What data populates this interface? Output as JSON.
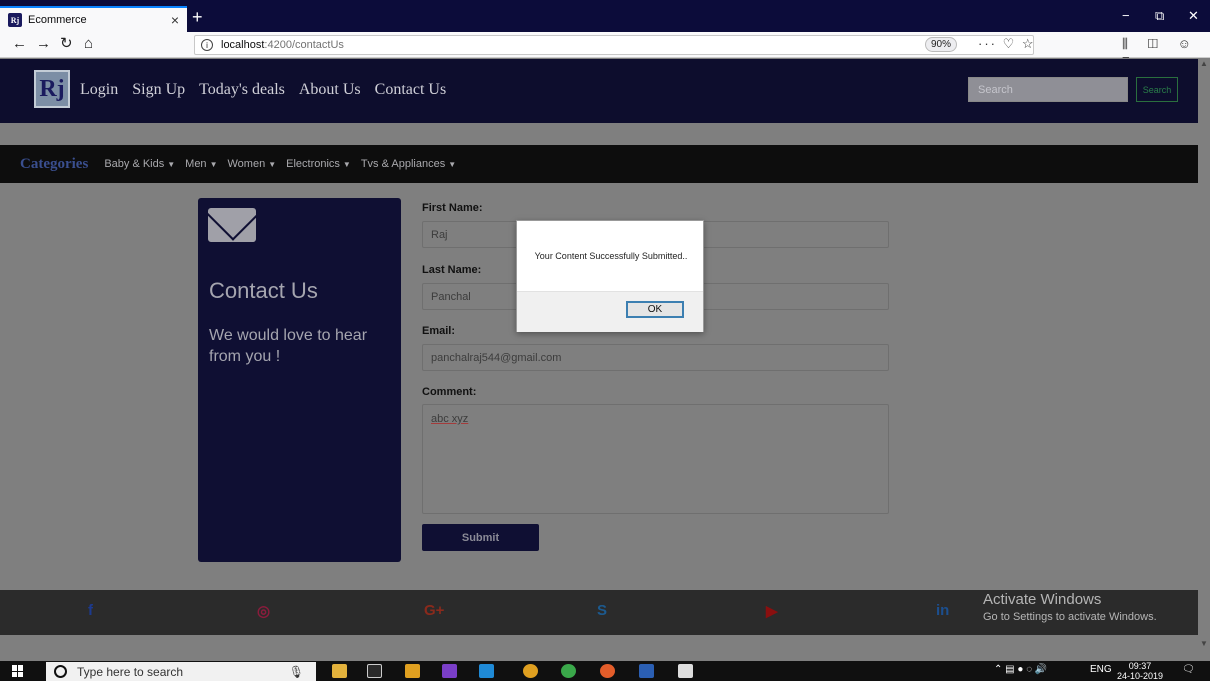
{
  "browser": {
    "tab_title": "Ecommerce",
    "tab_favicon": "Rj",
    "tab_close": "×",
    "new_tab": "+",
    "url_host": "localhost",
    "url_path": ":4200/contactUs",
    "zoom": "90%",
    "page_actions": "··· ♡ ☆",
    "tool_icons": "⫼ ◫ ☺ ≡",
    "win_min": "−",
    "win_max": "⧉",
    "win_close": "✕"
  },
  "header": {
    "logo_text": "Rj",
    "nav": [
      "Login",
      "Sign Up",
      "Today's deals",
      "About Us",
      "Contact Us"
    ],
    "search_placeholder": "Search",
    "search_button": "Search"
  },
  "categories": {
    "title": "Categories",
    "items": [
      "Baby & Kids",
      "Men",
      "Women",
      "Electronics",
      "Tvs & Appliances"
    ]
  },
  "contact_card": {
    "title": "Contact Us",
    "subtitle": "We would love to hear from you !"
  },
  "form": {
    "first_name_label": "First Name:",
    "first_name_value": "Raj",
    "last_name_label": "Last Name:",
    "last_name_value": "Panchal",
    "email_label": "Email:",
    "email_value": "panchalraj544@gmail.com",
    "comment_label": "Comment:",
    "comment_value": "abc xyz",
    "submit_label": "Submit"
  },
  "footer": {
    "social": [
      {
        "name": "facebook",
        "glyph": "f",
        "color": "#1c3a8f"
      },
      {
        "name": "instagram",
        "glyph": "◎",
        "color": "#8a1c3c"
      },
      {
        "name": "google-plus",
        "glyph": "G+",
        "color": "#8a2a1c"
      },
      {
        "name": "skype",
        "glyph": "S",
        "color": "#1c5a8f"
      },
      {
        "name": "youtube",
        "glyph": "▶",
        "color": "#8a0f0f"
      },
      {
        "name": "linkedin",
        "glyph": "in",
        "color": "#1c4f8f"
      }
    ]
  },
  "activation": {
    "line1": "Activate Windows",
    "line2": "Go to Settings to activate Windows."
  },
  "dialog": {
    "message": "Your Content Successfully Submitted..",
    "ok_label": "OK"
  },
  "taskbar": {
    "search_placeholder": "Type here to search",
    "lang": "ENG",
    "time": "09:37",
    "date": "24-10-2019"
  }
}
